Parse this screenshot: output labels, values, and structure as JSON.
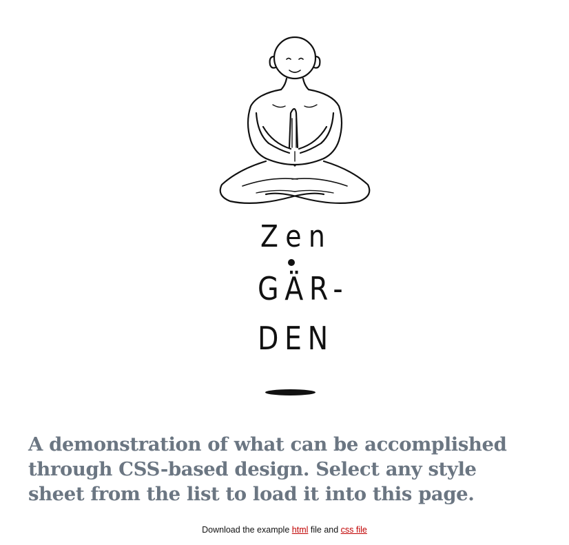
{
  "logo": {
    "icon": "meditating-figure-icon",
    "word_1": "Zen",
    "word_2": "GÄR-",
    "word_3": "DEN"
  },
  "intro": {
    "tagline": "A demonstration of what can be accomplished through CSS-based design. Select any style sheet from the list to load it into this page."
  },
  "downloads": {
    "prefix": "Download the example ",
    "html_link": "html",
    "middle": " file and ",
    "css_link": "css file"
  },
  "colors": {
    "tagline": "#6b7682",
    "link": "#c00000",
    "ink": "#111111"
  }
}
